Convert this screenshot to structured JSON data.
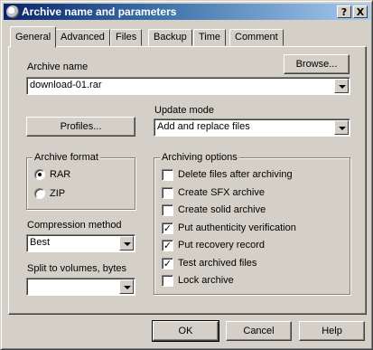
{
  "window": {
    "title": "Archive name and parameters"
  },
  "titlebar": {
    "help_glyph": "?",
    "close_glyph": "X"
  },
  "tabs": [
    {
      "label": "General",
      "active": true
    },
    {
      "label": "Advanced"
    },
    {
      "label": "Files"
    },
    {
      "label": "Backup"
    },
    {
      "label": "Time"
    },
    {
      "label": "Comment"
    }
  ],
  "archive_name": {
    "label": "Archive name",
    "value": "download-01.rar",
    "browse_label": "Browse..."
  },
  "profiles": {
    "label": "Profiles..."
  },
  "update_mode": {
    "label": "Update mode",
    "value": "Add and replace files"
  },
  "archive_format": {
    "title": "Archive format",
    "options": [
      {
        "label": "RAR",
        "selected": true
      },
      {
        "label": "ZIP",
        "selected": false
      }
    ]
  },
  "compression": {
    "label": "Compression method",
    "value": "Best"
  },
  "split": {
    "label": "Split to volumes, bytes",
    "value": ""
  },
  "archiving_options": {
    "title": "Archiving options",
    "items": [
      {
        "label": "Delete files after archiving",
        "checked": false
      },
      {
        "label": "Create SFX archive",
        "checked": false
      },
      {
        "label": "Create solid archive",
        "checked": false
      },
      {
        "label": "Put authenticity verification",
        "checked": true
      },
      {
        "label": "Put recovery record",
        "checked": true
      },
      {
        "label": "Test archived files",
        "checked": true
      },
      {
        "label": "Lock archive",
        "checked": false
      }
    ]
  },
  "footer": {
    "ok": "OK",
    "cancel": "Cancel",
    "help": "Help"
  },
  "glyphs": {
    "check_mark": "✓"
  },
  "colors": {
    "dialog_bg": "#d4d0c8",
    "titlebar_start": "#0a246a",
    "titlebar_end": "#a6caf0"
  }
}
